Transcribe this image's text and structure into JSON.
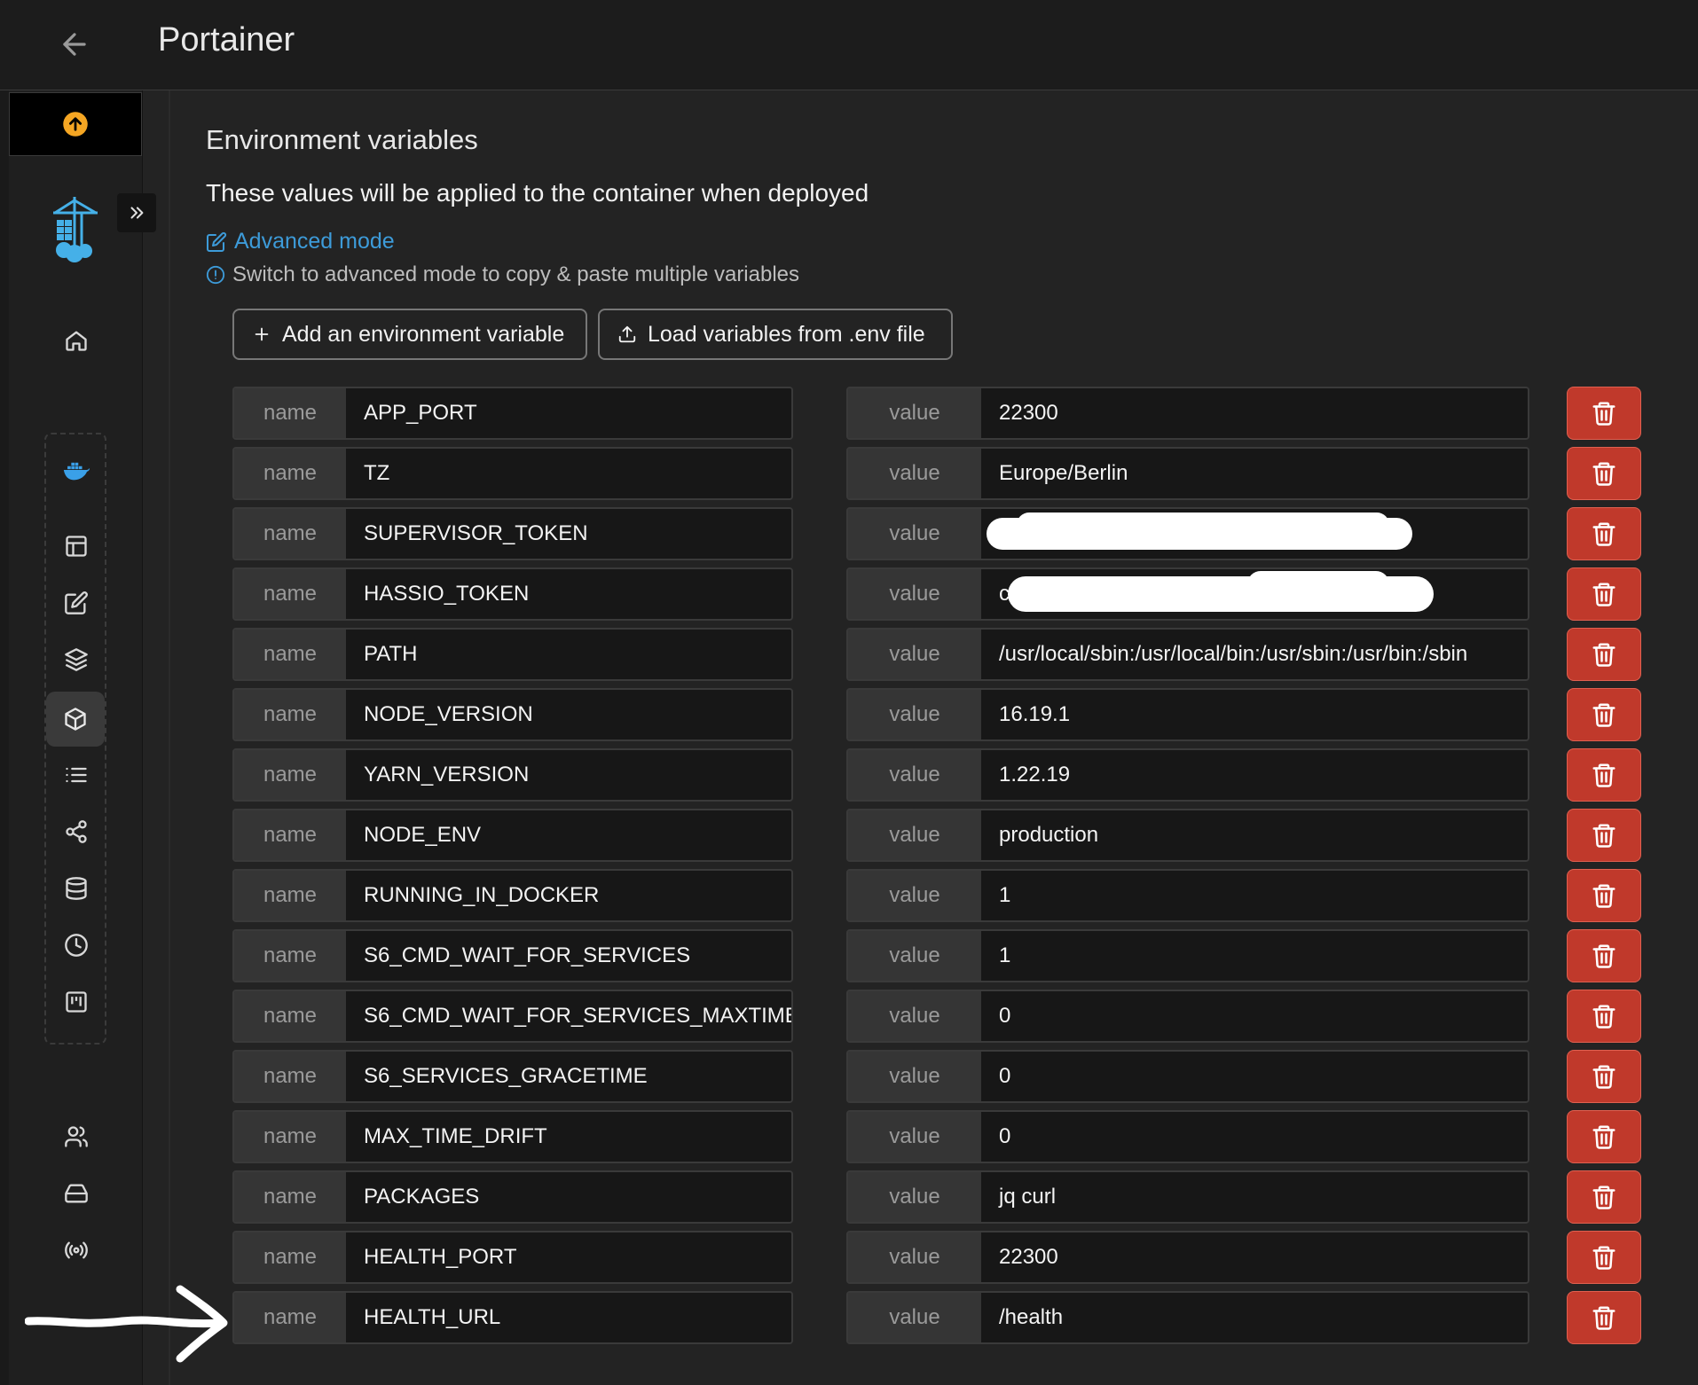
{
  "header": {
    "title": "Portainer",
    "back_icon": "arrow-left-icon"
  },
  "sidebar": {
    "update_icon": "arrow-up-circle-icon",
    "logo": "portainer-logo",
    "expand_icon": "double-chevron-right-icon",
    "items": [
      {
        "icon": "home-icon"
      },
      {
        "icon": "docker-icon"
      },
      {
        "icon": "dashboard-icon"
      },
      {
        "icon": "edit-icon"
      },
      {
        "icon": "layers-icon"
      },
      {
        "icon": "cube-icon",
        "active": true
      },
      {
        "icon": "list-icon"
      },
      {
        "icon": "share-icon"
      },
      {
        "icon": "database-icon"
      },
      {
        "icon": "clock-icon"
      },
      {
        "icon": "kanban-icon"
      },
      {
        "icon": "users-icon"
      },
      {
        "icon": "hard-drive-icon"
      },
      {
        "icon": "broadcast-icon"
      }
    ]
  },
  "section": {
    "title": "Environment variables",
    "description": "These values will be applied to the container when deployed",
    "advanced_mode_label": "Advanced mode",
    "advanced_hint": "Switch to advanced mode to copy & paste multiple variables",
    "add_button_label": "Add an environment variable",
    "load_button_label": "Load variables from .env file",
    "name_addon": "name",
    "value_addon": "value"
  },
  "env_vars": [
    {
      "name": "APP_PORT",
      "value": "22300"
    },
    {
      "name": "TZ",
      "value": "Europe/Berlin"
    },
    {
      "name": "SUPERVISOR_TOKEN",
      "value": ""
    },
    {
      "name": "HASSIO_TOKEN",
      "value": "cz"
    },
    {
      "name": "PATH",
      "value": "/usr/local/sbin:/usr/local/bin:/usr/sbin:/usr/bin:/sbin"
    },
    {
      "name": "NODE_VERSION",
      "value": "16.19.1"
    },
    {
      "name": "YARN_VERSION",
      "value": "1.22.19"
    },
    {
      "name": "NODE_ENV",
      "value": "production"
    },
    {
      "name": "RUNNING_IN_DOCKER",
      "value": "1"
    },
    {
      "name": "S6_CMD_WAIT_FOR_SERVICES",
      "value": "1"
    },
    {
      "name": "S6_CMD_WAIT_FOR_SERVICES_MAXTIME",
      "value": "0"
    },
    {
      "name": "S6_SERVICES_GRACETIME",
      "value": "0"
    },
    {
      "name": "MAX_TIME_DRIFT",
      "value": "0"
    },
    {
      "name": "PACKAGES",
      "value": "jq    curl"
    },
    {
      "name": "HEALTH_PORT",
      "value": "22300"
    },
    {
      "name": "HEALTH_URL",
      "value": "/health"
    }
  ],
  "colors": {
    "accent_link": "#3d9bd9",
    "danger": "#c0392b",
    "update_badge": "#f5a623"
  }
}
